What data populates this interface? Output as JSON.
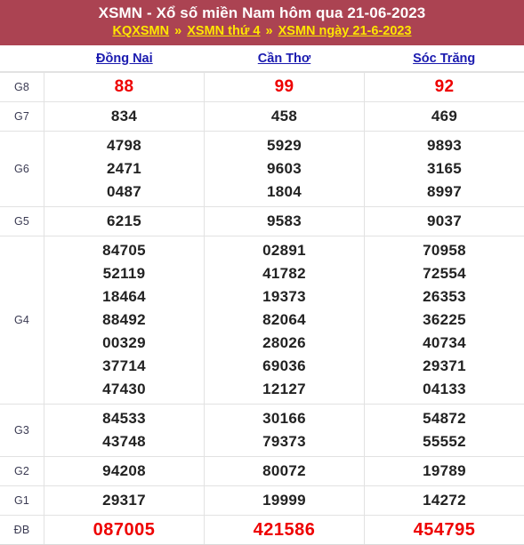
{
  "header": {
    "title": "XSMN - Xổ số miền Nam hôm qua 21-06-2023",
    "breadcrumb": [
      {
        "label": "KQXSMN",
        "type": "link"
      },
      {
        "label": "»",
        "type": "separator"
      },
      {
        "label": "XSMN thứ 4",
        "type": "link"
      },
      {
        "label": "»",
        "type": "separator"
      },
      {
        "label": "XSMN ngày 21-6-2023",
        "type": "link"
      }
    ],
    "background_color": "#ab4352",
    "title_color": "#ffffff",
    "link_color": "#ffe600"
  },
  "table": {
    "provinces": [
      {
        "name": "Đồng Nai"
      },
      {
        "name": "Cần Thơ"
      },
      {
        "name": "Sóc Trăng"
      }
    ],
    "province_link_color": "#1a1aaf",
    "highlight_color": "#ee0000",
    "rows": [
      {
        "prize": "G8",
        "style": "highlight",
        "values": [
          [
            "88"
          ],
          [
            "99"
          ],
          [
            "92"
          ]
        ]
      },
      {
        "prize": "G7",
        "style": "normal",
        "values": [
          [
            "834"
          ],
          [
            "458"
          ],
          [
            "469"
          ]
        ]
      },
      {
        "prize": "G6",
        "style": "normal",
        "values": [
          [
            "4798",
            "2471",
            "0487"
          ],
          [
            "5929",
            "9603",
            "1804"
          ],
          [
            "9893",
            "3165",
            "8997"
          ]
        ]
      },
      {
        "prize": "G5",
        "style": "normal",
        "values": [
          [
            "6215"
          ],
          [
            "9583"
          ],
          [
            "9037"
          ]
        ]
      },
      {
        "prize": "G4",
        "style": "normal",
        "values": [
          [
            "84705",
            "52119",
            "18464",
            "88492",
            "00329",
            "37714",
            "47430"
          ],
          [
            "02891",
            "41782",
            "19373",
            "82064",
            "28026",
            "69036",
            "12127"
          ],
          [
            "70958",
            "72554",
            "26353",
            "36225",
            "40734",
            "29371",
            "04133"
          ]
        ]
      },
      {
        "prize": "G3",
        "style": "normal",
        "values": [
          [
            "84533",
            "43748"
          ],
          [
            "30166",
            "79373"
          ],
          [
            "54872",
            "55552"
          ]
        ]
      },
      {
        "prize": "G2",
        "style": "normal",
        "values": [
          [
            "94208"
          ],
          [
            "80072"
          ],
          [
            "19789"
          ]
        ]
      },
      {
        "prize": "G1",
        "style": "normal",
        "values": [
          [
            "29317"
          ],
          [
            "19999"
          ],
          [
            "14272"
          ]
        ]
      },
      {
        "prize": "ĐB",
        "style": "special",
        "values": [
          [
            "087005"
          ],
          [
            "421586"
          ],
          [
            "454795"
          ]
        ]
      }
    ]
  }
}
